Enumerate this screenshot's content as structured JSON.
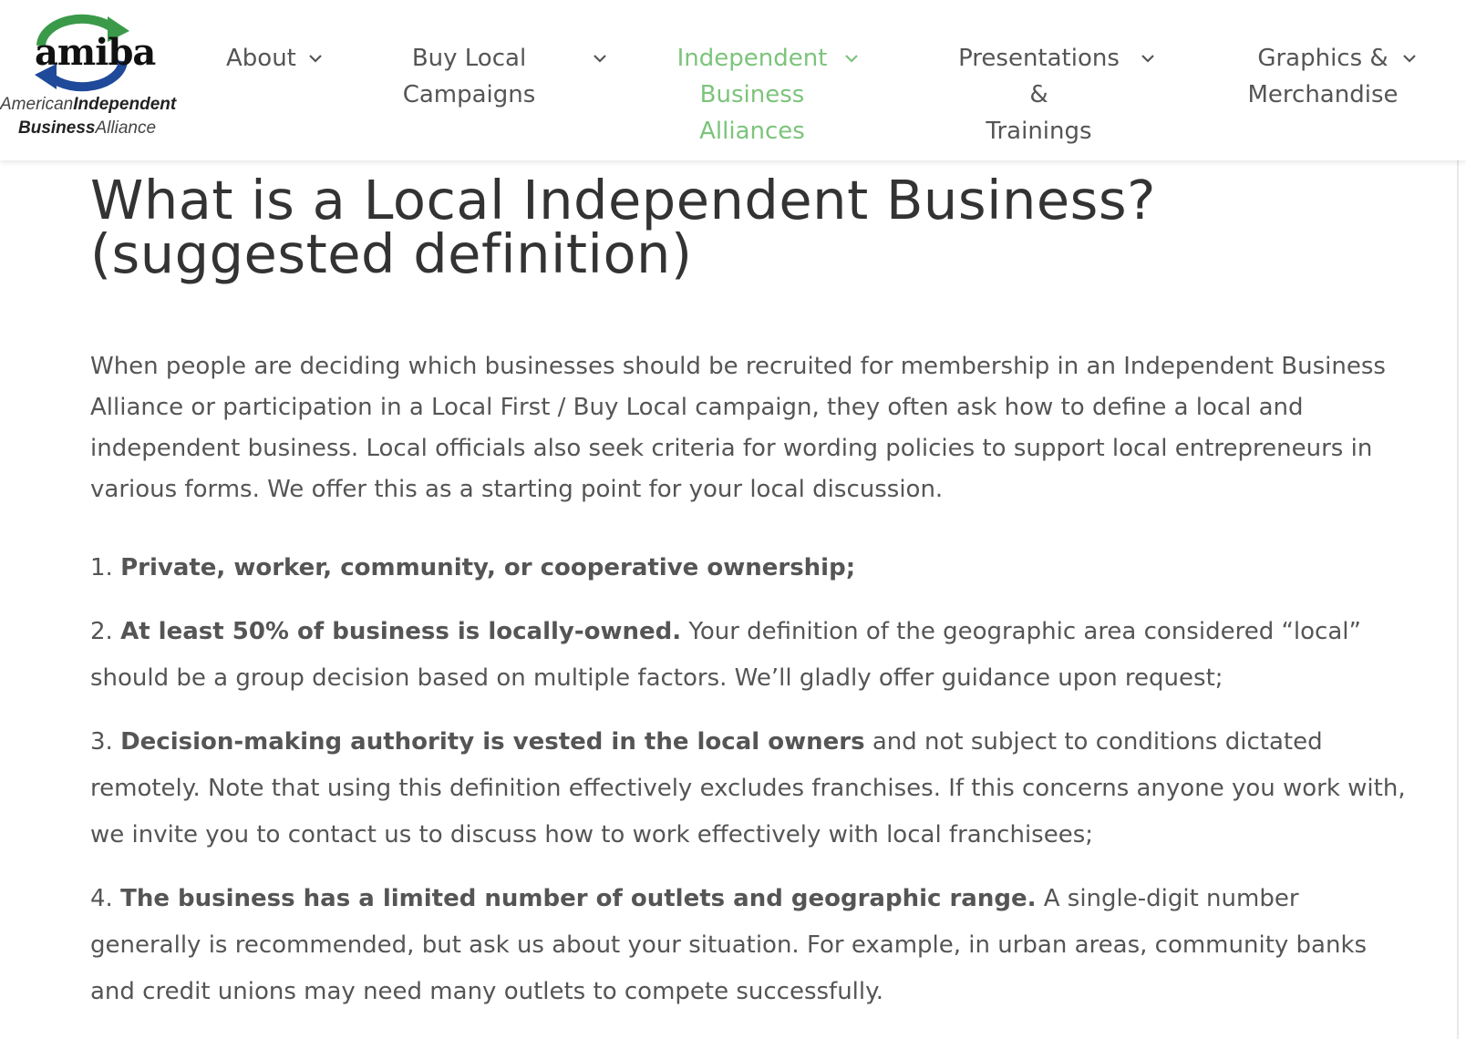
{
  "colors": {
    "nav_text": "#555555",
    "nav_active": "#7cc47c",
    "heading": "#333333",
    "body_text": "#555555",
    "logo_green": "#3a9a4a",
    "logo_blue": "#1f4a9a"
  },
  "logo": {
    "word": "amiba",
    "line1_thin": "American",
    "line1_bold": "Independent",
    "line2_bold": "Business",
    "line2_thin": "Alliance"
  },
  "nav": {
    "items": [
      {
        "line1": "About",
        "line2": "",
        "active": false,
        "icon": "chevron-down-icon"
      },
      {
        "line1": "Buy Local",
        "line2": "Campaigns",
        "active": false,
        "icon": "chevron-down-icon"
      },
      {
        "line1": "Independent",
        "line2": "Business Alliances",
        "active": true,
        "icon": "chevron-down-icon"
      },
      {
        "line1": "Presentations &",
        "line2": "Trainings",
        "active": false,
        "icon": "chevron-down-icon"
      },
      {
        "line1": "Graphics &",
        "line2": "Merchandise",
        "active": false,
        "icon": "chevron-down-icon"
      }
    ]
  },
  "article": {
    "title": "What is a Local Independent Business? (suggested definition)",
    "intro": "When people are deciding which businesses should be recruited for membership in an Independent Business Alliance or participation in a Local First / Buy Local campaign, they often ask how to define a local and independent business. Local officials also seek criteria for wording policies to support local entrepreneurs in various forms. We offer this as a starting point for your local discussion.",
    "criteria": [
      {
        "number": "1.",
        "bold": "Private, worker, community, or cooperative ownership;",
        "text": ""
      },
      {
        "number": "2.",
        "bold": "At least 50% of business is locally-owned.",
        "text": "Your definition of the geographic area considered “local” should be a group decision based on multiple factors. We’ll gladly offer guidance upon request;"
      },
      {
        "number": "3.",
        "bold": "Decision-making authority is vested in the local owners",
        "text": "and not subject to conditions dictated remotely. Note that using this definition effectively excludes franchises. If this concerns anyone you work with, we invite you to contact us to discuss how to work effectively with local franchisees;"
      },
      {
        "number": "4.",
        "bold": "The business has a limited number of outlets and geographic range.",
        "text": "A single-digit number generally is recommended, but ask us about your situation. For example, in urban areas, community banks and credit unions may need many outlets to compete successfully."
      }
    ]
  }
}
